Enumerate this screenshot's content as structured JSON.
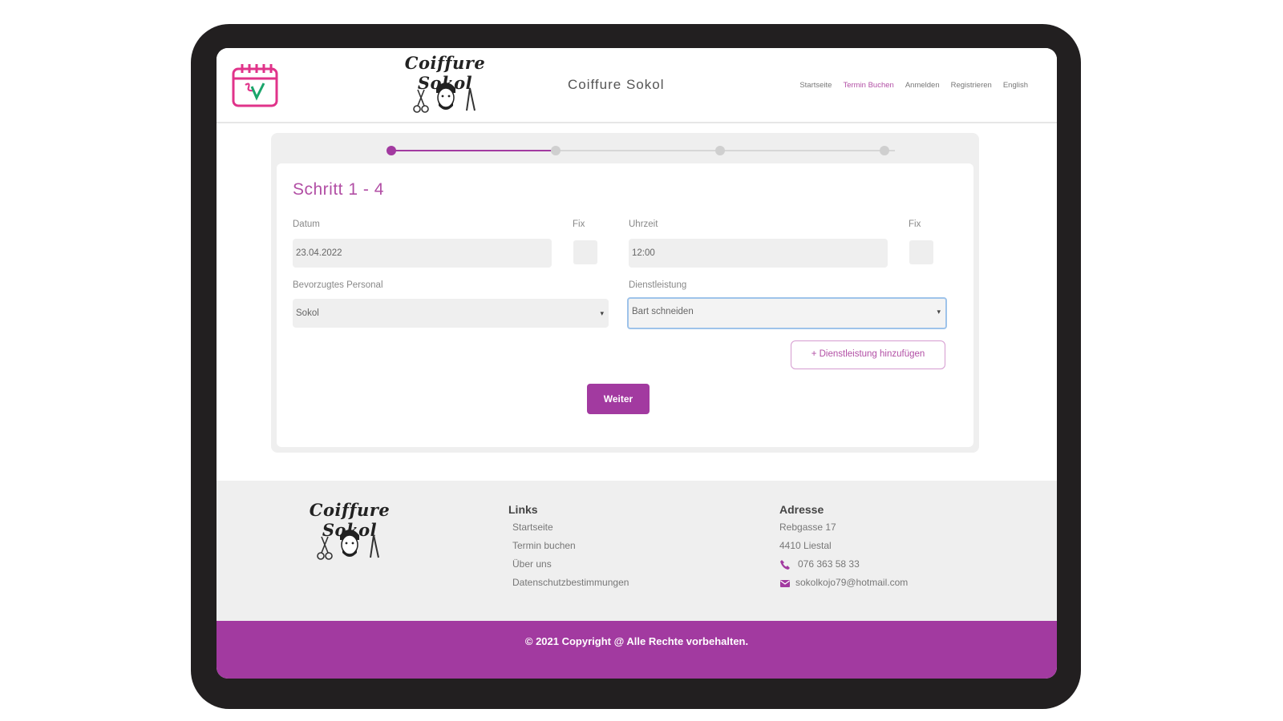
{
  "header": {
    "brand_script": "Coiffure Sokol",
    "site_title": "Coiffure Sokol",
    "nav": [
      {
        "label": "Startseite",
        "active": false
      },
      {
        "label": "Termin Buchen",
        "active": true
      },
      {
        "label": "Anmelden",
        "active": false
      },
      {
        "label": "Registrieren",
        "active": false
      },
      {
        "label": "English",
        "active": false
      }
    ]
  },
  "progress": {
    "steps": 4,
    "current": 1
  },
  "form": {
    "title": "Schritt 1 - 4",
    "date_label": "Datum",
    "date_value": "23.04.2022",
    "date_fix_label": "Fix",
    "time_label": "Uhrzeit",
    "time_value": "12:00",
    "time_fix_label": "Fix",
    "staff_label": "Bevorzugtes Personal",
    "staff_value": "Sokol",
    "service_label": "Dienstleistung",
    "service_value": "Bart schneiden",
    "add_service_label": "+ Dienstleistung hinzufügen",
    "next_label": "Weiter"
  },
  "footer": {
    "brand_script": "Coiffure Sokol",
    "links_title": "Links",
    "links": [
      "Startseite",
      "Termin buchen",
      "Über uns",
      "Datenschutzbestimmungen"
    ],
    "address_title": "Adresse",
    "street": "Rebgasse 17",
    "city": "4410 Liestal",
    "phone": "076 363 58 33",
    "email": "sokolkojo79@hotmail.com",
    "copyright": "© 2021 Copyright @ Alle Rechte vorbehalten."
  },
  "colors": {
    "accent": "#a23aa0",
    "accent_light": "#b24fa5",
    "frame": "#221f20",
    "calendar_pink": "#e0338a",
    "calendar_check": "#1aa56b"
  },
  "icons": [
    "calendar-check-icon",
    "scissors-icon",
    "barber-face-icon",
    "razor-icon",
    "phone-icon",
    "mail-icon",
    "chevron-down-icon"
  ]
}
